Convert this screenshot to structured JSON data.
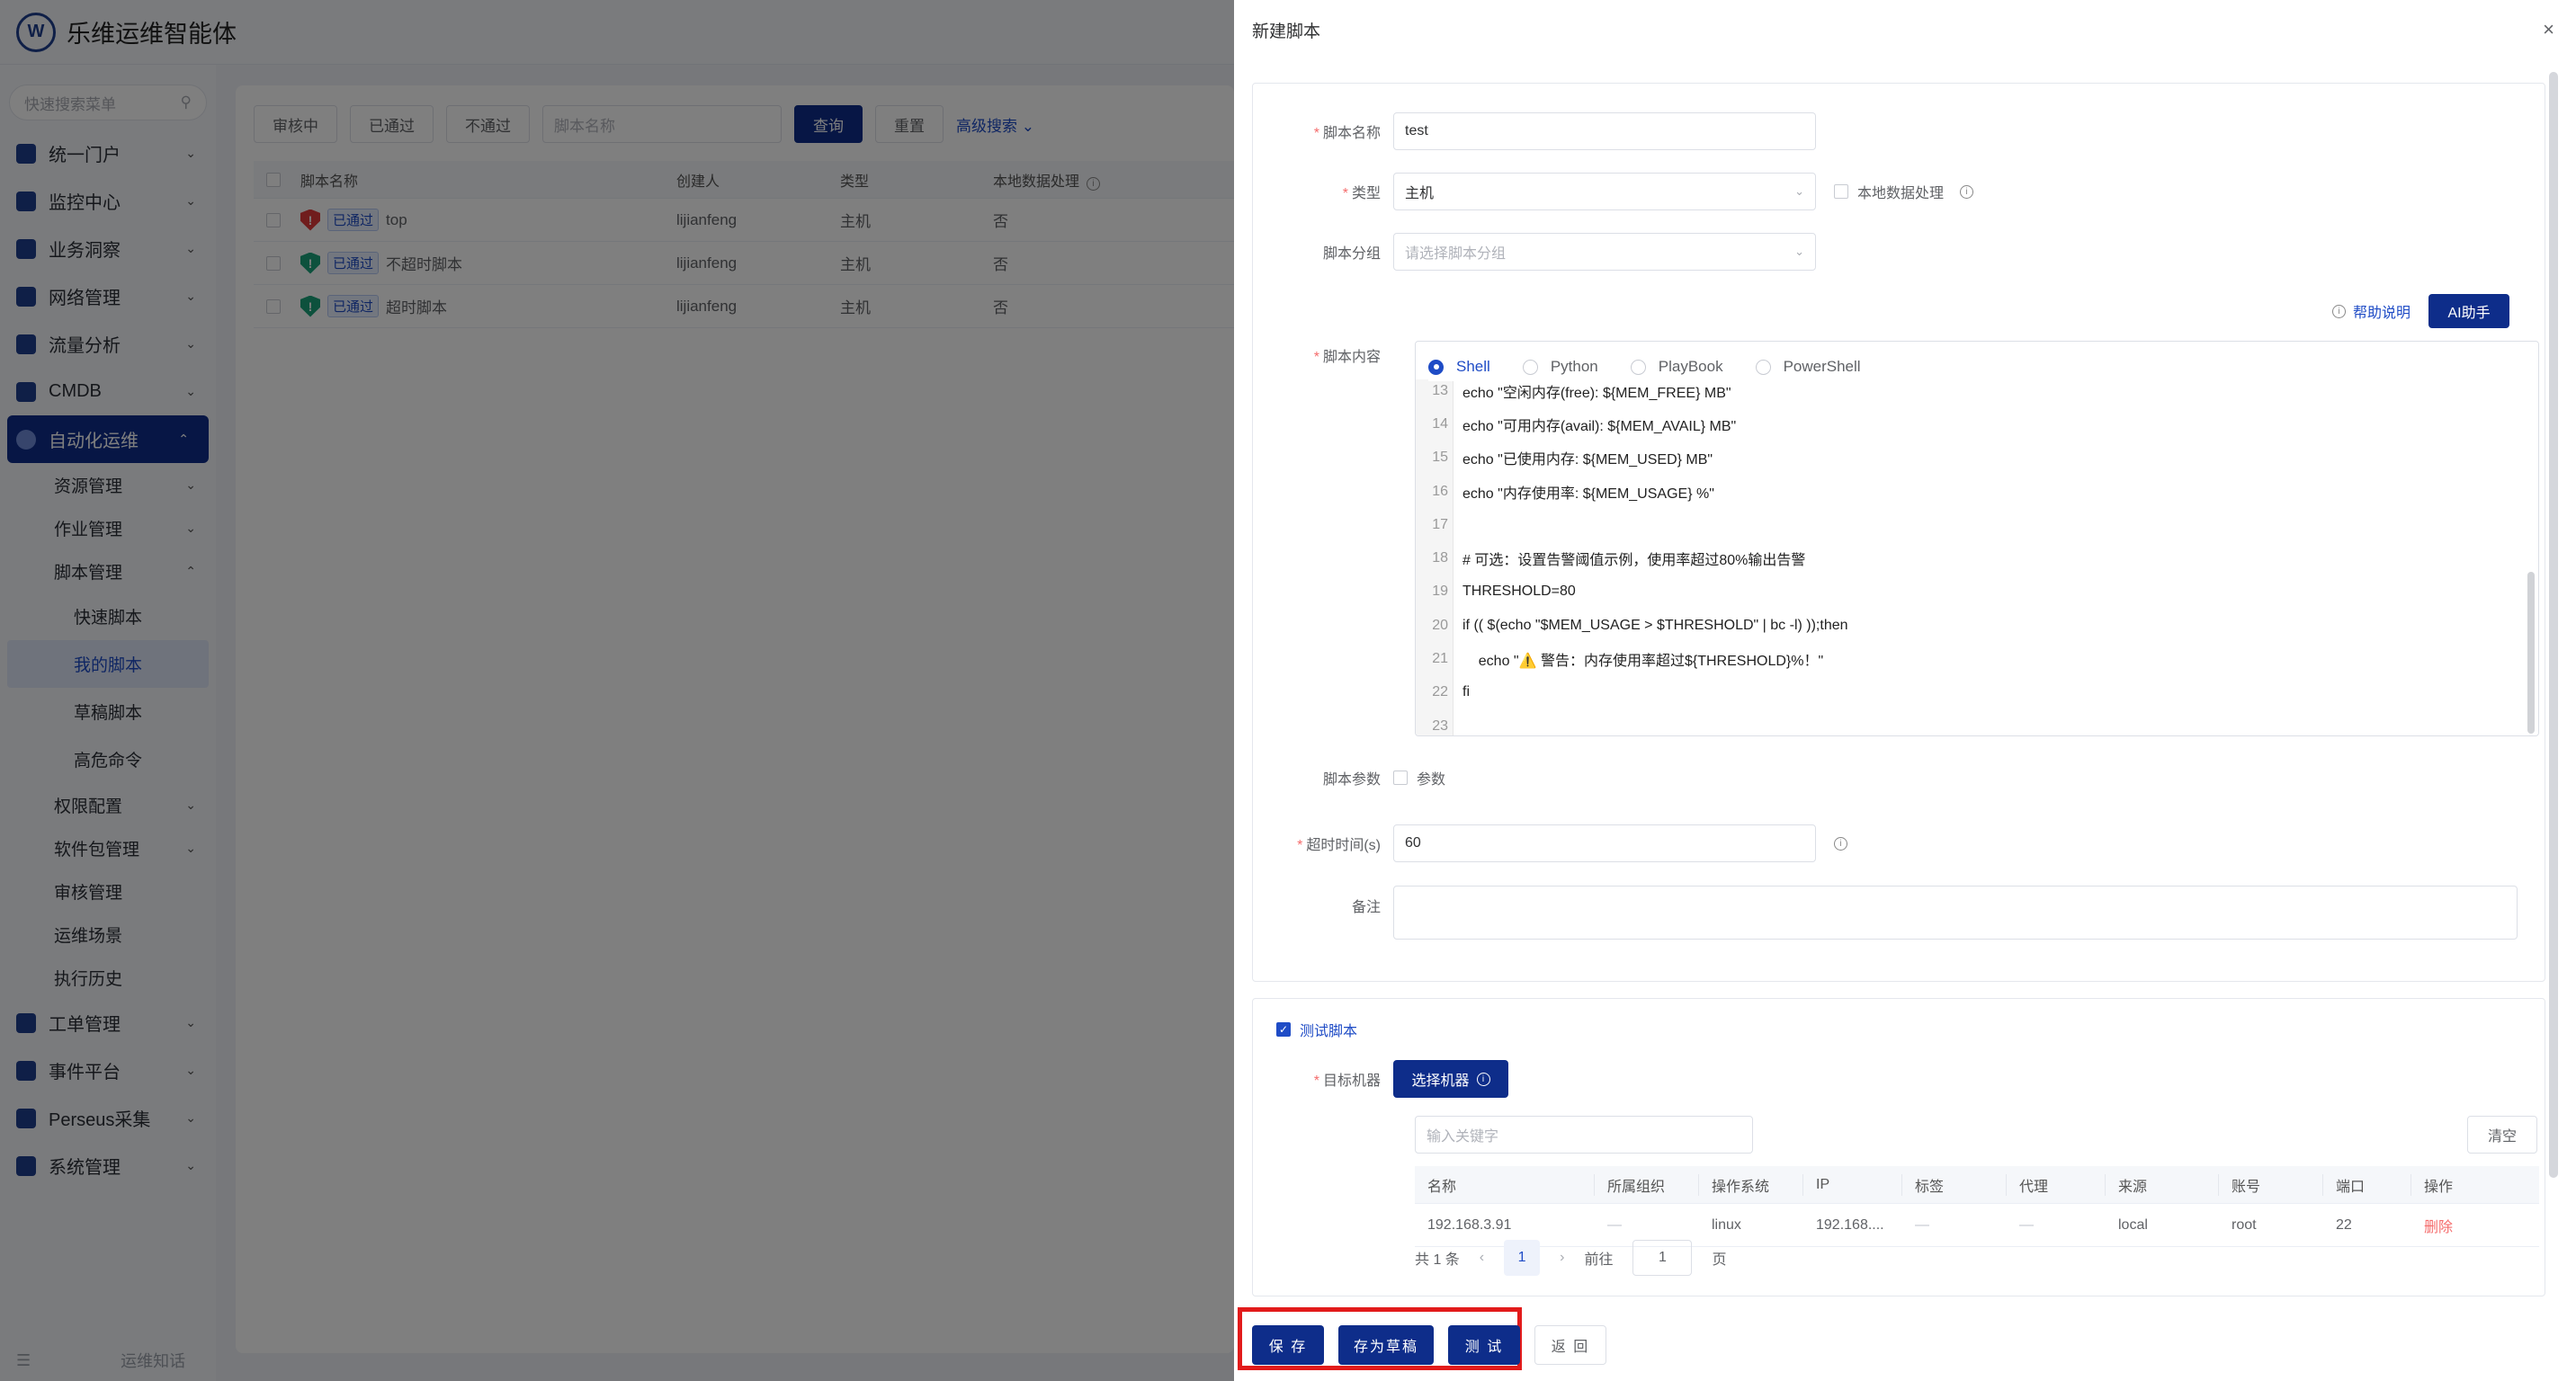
{
  "app": {
    "logo_text": "W",
    "title": "乐维运维智能体",
    "sidebar": {
      "search_placeholder": "快速搜索菜单",
      "menus": [
        {
          "label": "统一门户"
        },
        {
          "label": "监控中心"
        },
        {
          "label": "业务洞察"
        },
        {
          "label": "网络管理"
        },
        {
          "label": "流量分析"
        },
        {
          "label": "CMDB"
        }
      ],
      "active_menu": "自动化运维",
      "auto_sub": [
        {
          "label": "资源管理"
        },
        {
          "label": "作业管理"
        },
        {
          "label": "脚本管理"
        }
      ],
      "script_leaves": [
        "快速脚本",
        "我的脚本",
        "草稿脚本",
        "高危命令"
      ],
      "auto_sub2": [
        {
          "label": "权限配置",
          "chev": true
        },
        {
          "label": "软件包管理",
          "chev": true
        },
        {
          "label": "审核管理",
          "chev": false
        },
        {
          "label": "运维场景",
          "chev": false
        },
        {
          "label": "执行历史",
          "chev": false
        }
      ],
      "menus_bottom": [
        {
          "label": "工单管理"
        },
        {
          "label": "事件平台"
        },
        {
          "label": "Perseus采集"
        },
        {
          "label": "系统管理"
        }
      ],
      "bottom_link": "运维知话"
    },
    "filters": {
      "tabs": [
        "审核中",
        "已通过",
        "不通过"
      ],
      "search_placeholder": "脚本名称",
      "query": "查询",
      "reset": "重置",
      "advanced": "高级搜索"
    },
    "table": {
      "headers": [
        "脚本名称",
        "创建人",
        "类型",
        "本地数据处理"
      ],
      "rows": [
        {
          "status": "已通过",
          "name": "top",
          "creator": "lijianfeng",
          "type": "主机",
          "local": "否",
          "shield": "red"
        },
        {
          "status": "已通过",
          "name": "不超时脚本",
          "creator": "lijianfeng",
          "type": "主机",
          "local": "否",
          "shield": "green"
        },
        {
          "status": "已通过",
          "name": "超时脚本",
          "creator": "lijianfeng",
          "type": "主机",
          "local": "否",
          "shield": "green"
        }
      ]
    }
  },
  "drawer": {
    "title": "新建脚本",
    "form": {
      "name_label": "脚本名称",
      "name_value": "test",
      "type_label": "类型",
      "type_value": "主机",
      "local_label": "本地数据处理",
      "group_label": "脚本分组",
      "group_placeholder": "请选择脚本分组",
      "help": "帮助说明",
      "ai": "AI助手",
      "content_label": "脚本内容",
      "langs": [
        "Shell",
        "Python",
        "PlayBook",
        "PowerShell"
      ],
      "selected_lang": "Shell",
      "code": [
        {
          "n": "13",
          "text": "echo \"空闲内存(free): ${MEM_FREE} MB\""
        },
        {
          "n": "14",
          "text": "echo \"可用内存(avail): ${MEM_AVAIL} MB\""
        },
        {
          "n": "15",
          "text": "echo \"已使用内存: ${MEM_USED} MB\""
        },
        {
          "n": "16",
          "text": "echo \"内存使用率: ${MEM_USAGE} %\""
        },
        {
          "n": "17",
          "text": ""
        },
        {
          "n": "18",
          "text": "# 可选：设置告警阈值示例，使用率超过80%输出告警"
        },
        {
          "n": "19",
          "text": "THRESHOLD=80"
        },
        {
          "n": "20",
          "text": "if (( $(echo \"$MEM_USAGE > $THRESHOLD\" | bc -l) ));then"
        },
        {
          "n": "21",
          "text": "    echo \"⚠️ 警告：内存使用率超过${THRESHOLD}%！\""
        },
        {
          "n": "22",
          "text": "fi"
        },
        {
          "n": "23",
          "text": ""
        }
      ],
      "params_label": "脚本参数",
      "params_check": "参数",
      "timeout_label": "超时时间(s)",
      "timeout_value": "60",
      "remark_label": "备注"
    },
    "test": {
      "check_label": "测试脚本",
      "target_label": "目标机器",
      "select_btn": "选择机器",
      "keyword_placeholder": "输入关键字",
      "clear": "清空",
      "headers": [
        "名称",
        "所属组织",
        "操作系统",
        "IP",
        "标签",
        "代理",
        "来源",
        "账号",
        "端口",
        "操作"
      ],
      "rows": [
        [
          "192.168.3.91",
          "—",
          "linux",
          "192.168....",
          "—",
          "—",
          "local",
          "root",
          "22",
          "删除"
        ]
      ],
      "pager": {
        "total": "共 1 条",
        "page": "1",
        "goto": "前往",
        "goto_value": "1",
        "unit": "页"
      }
    },
    "footer": {
      "save": "保 存",
      "draft": "存为草稿",
      "test": "测 试",
      "back": "返 回"
    }
  }
}
